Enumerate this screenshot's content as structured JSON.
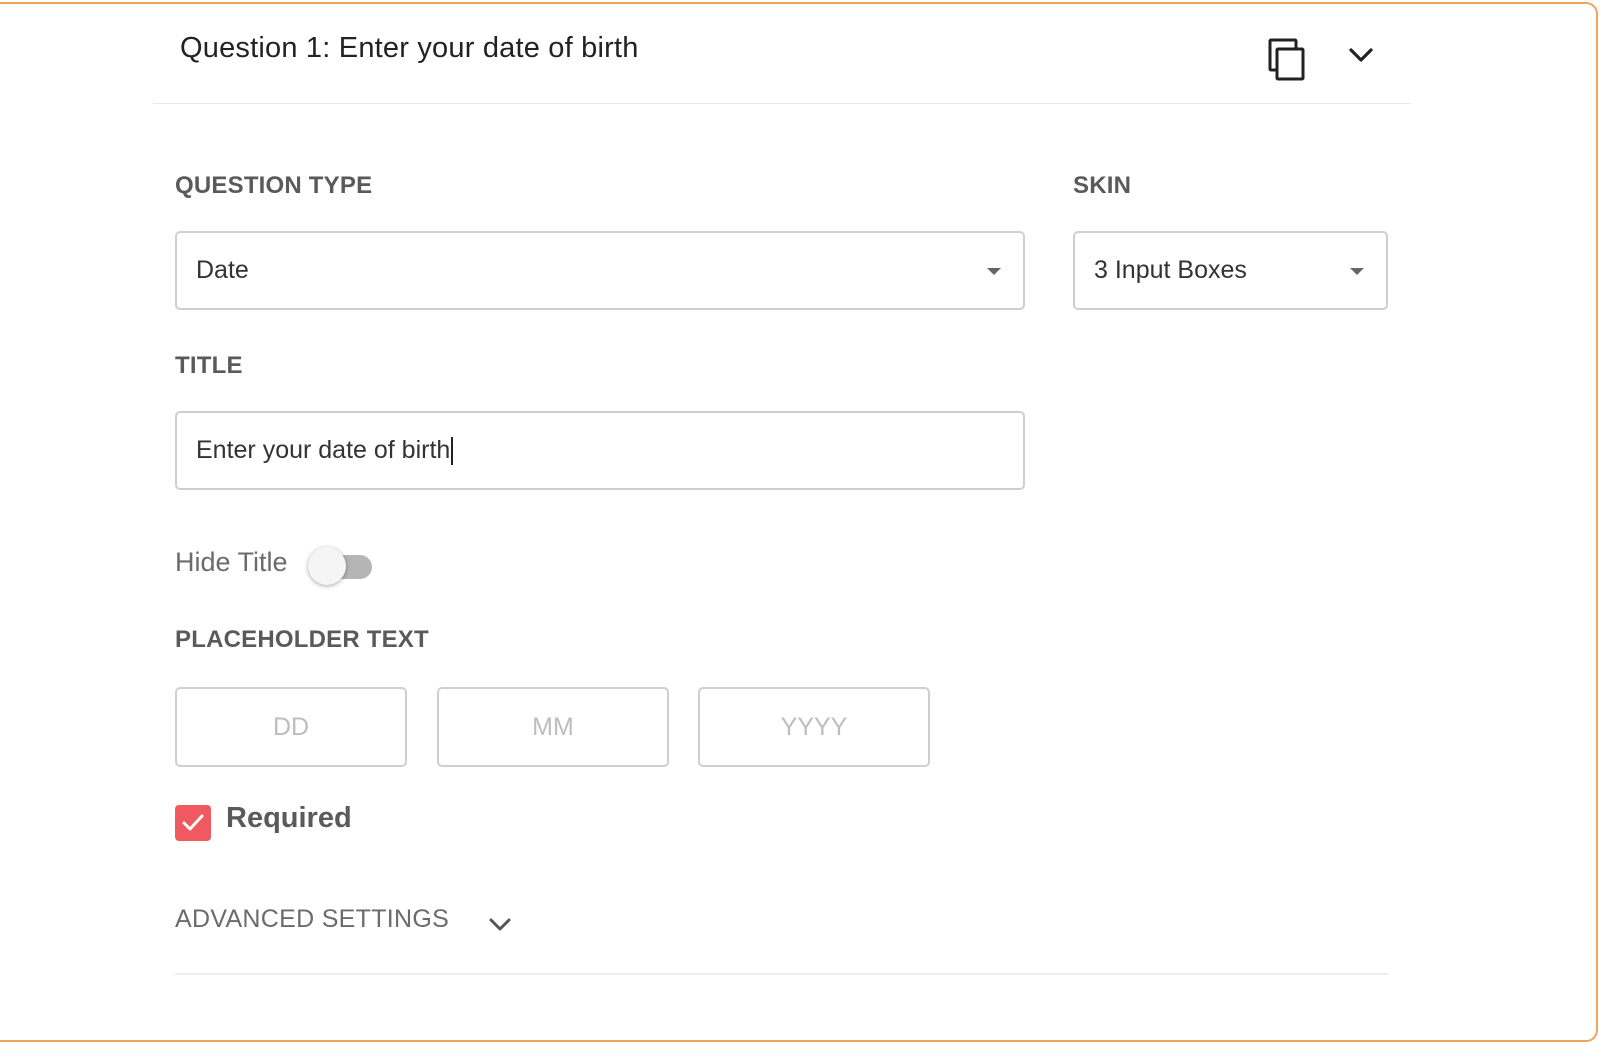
{
  "header": {
    "title": "Question 1: Enter your date of birth",
    "copy_icon": "copy-icon",
    "collapse_icon": "chevron-down-icon"
  },
  "question_type": {
    "label": "QUESTION TYPE",
    "value": "Date"
  },
  "skin": {
    "label": "SKIN",
    "value": "3 Input Boxes"
  },
  "title_field": {
    "label": "TITLE",
    "value": "Enter your date of birth"
  },
  "hide_title": {
    "label": "Hide Title",
    "on": false
  },
  "placeholder_text": {
    "label": "PLACEHOLDER TEXT",
    "day": "DD",
    "month": "MM",
    "year": "YYYY"
  },
  "required": {
    "label": "Required",
    "checked": true
  },
  "advanced_settings": {
    "label": "ADVANCED SETTINGS"
  },
  "colors": {
    "card_border": "#f0a35a",
    "checkbox_accent": "#f0595f",
    "label_text": "#5a5a5a",
    "input_border": "#cfcfcf",
    "toggle_track": "#b5b5b5"
  }
}
